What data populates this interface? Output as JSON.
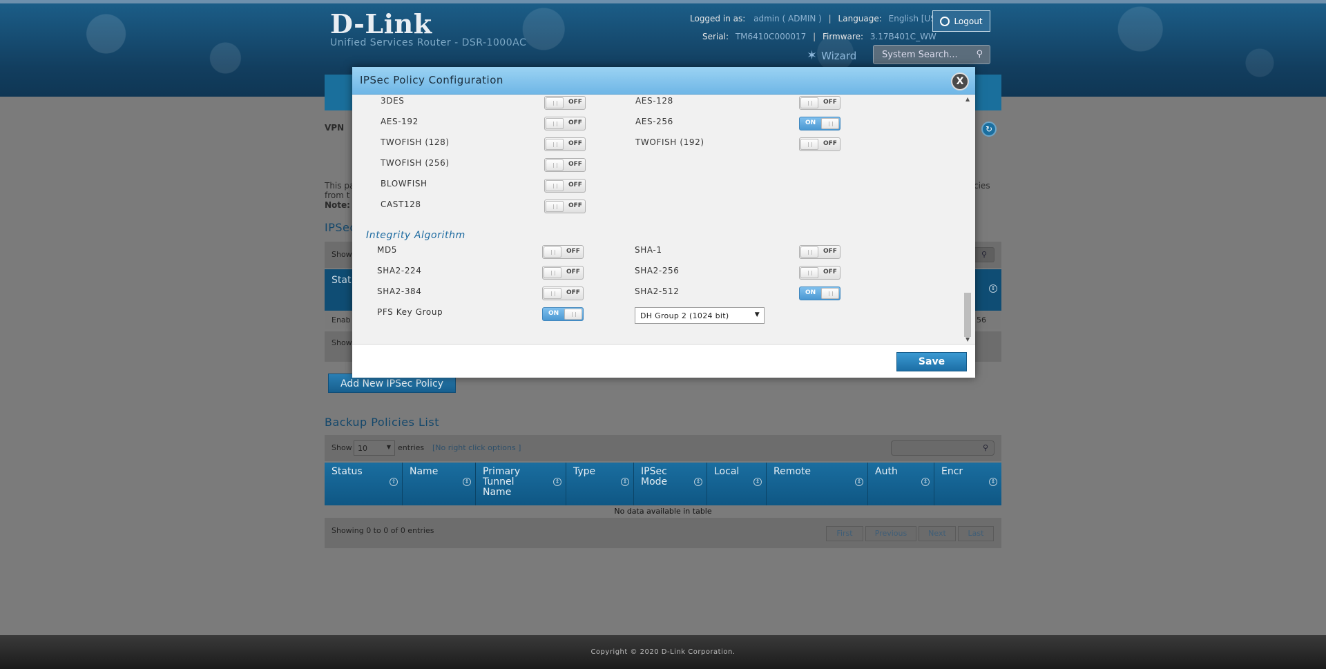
{
  "header": {
    "brand": "D-Link",
    "subtitle": "Unified Services Router - DSR-1000AC",
    "logged_in_label": "Logged in as:",
    "logged_in_value": "admin ( ADMIN )",
    "language_label": "Language:",
    "language_value": "English [US]",
    "serial_label": "Serial:",
    "serial_value": "TM6410C000017",
    "firmware_label": "Firmware:",
    "firmware_value": "3.17B401C_WW",
    "logout_label": "Logout",
    "wizard_label": "Wizard",
    "search_placeholder": "System Search..."
  },
  "page": {
    "breadcrumb": "VPN",
    "desc_line1": "This pa",
    "desc_line2": "from t",
    "note_label": "Note:",
    "desc_right": "cies",
    "section_ipsec": "IPSec",
    "show_label_1": "Show",
    "status_partial": "Stat",
    "row_partial": "Enab",
    "row_partial_right": "56",
    "show_label_2": "Show",
    "add_button": "Add New IPSec Policy",
    "backup_title": "Backup Policies List",
    "show_label": "Show",
    "entries_value": "10",
    "entries_label": "entries",
    "no_right_click": "[No right click options ]",
    "columns": [
      "Status",
      "Name",
      "Primary Tunnel Name",
      "Type",
      "IPSec Mode",
      "Local",
      "Remote",
      "Auth",
      "Encr"
    ],
    "col_primary_1": "Primary",
    "col_primary_2": "Tunnel",
    "col_primary_3": "Name",
    "col_ipsec_1": "IPSec",
    "col_ipsec_2": "Mode",
    "no_data": "No data available in table",
    "showing": "Showing 0 to 0 of 0 entries",
    "pager": [
      "First",
      "Previous",
      "Next",
      "Last"
    ]
  },
  "modal": {
    "title": "IPSec Policy Configuration",
    "close": "X",
    "encryption": [
      {
        "label": "3DES",
        "state": "OFF"
      },
      {
        "label": "AES-128",
        "state": "OFF"
      },
      {
        "label": "AES-192",
        "state": "OFF"
      },
      {
        "label": "AES-256",
        "state": "ON"
      },
      {
        "label": "TWOFISH (128)",
        "state": "OFF"
      },
      {
        "label": "TWOFISH (192)",
        "state": "OFF"
      },
      {
        "label": "TWOFISH (256)",
        "state": "OFF"
      },
      {
        "label": "BLOWFISH",
        "state": "OFF"
      },
      {
        "label": "CAST128",
        "state": "OFF"
      }
    ],
    "integrity_title": "Integrity Algorithm",
    "integrity": [
      {
        "label": "MD5",
        "state": "OFF"
      },
      {
        "label": "SHA-1",
        "state": "OFF"
      },
      {
        "label": "SHA2-224",
        "state": "OFF"
      },
      {
        "label": "SHA2-256",
        "state": "OFF"
      },
      {
        "label": "SHA2-384",
        "state": "OFF"
      },
      {
        "label": "SHA2-512",
        "state": "ON"
      }
    ],
    "pfs_label": "PFS Key Group",
    "pfs_state": "ON",
    "dh_group": "DH Group 2 (1024 bit)",
    "save": "Save"
  },
  "footer": {
    "copyright": "Copyright © 2020 D-Link Corporation."
  }
}
